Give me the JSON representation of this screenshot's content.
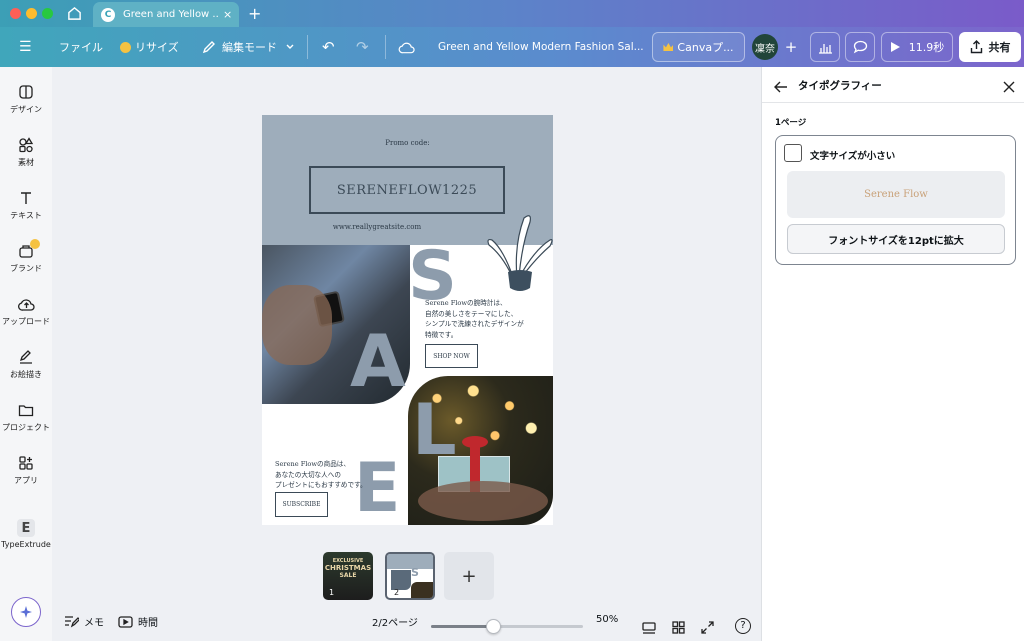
{
  "browser": {
    "tab_title": "Green and Yellow ...",
    "tab_close": "×",
    "new_tab": "+"
  },
  "toolbar": {
    "menu": "☰",
    "file": "ファイル",
    "resize": "リサイズ",
    "edit_mode": "編集モード",
    "undo": "↶",
    "redo": "↷",
    "doc_title": "Green and Yellow Modern Fashion Sal...",
    "canva_pro": "Canvaプ...",
    "avatar": "凜奈",
    "add": "+",
    "timer": "11.9秒",
    "share": "共有"
  },
  "sidebar": {
    "items": [
      {
        "label": "デザイン",
        "icon": "design-icon"
      },
      {
        "label": "素材",
        "icon": "elements-icon"
      },
      {
        "label": "テキスト",
        "icon": "text-icon"
      },
      {
        "label": "ブランド",
        "icon": "brand-icon"
      },
      {
        "label": "アップロード",
        "icon": "upload-icon"
      },
      {
        "label": "お絵描き",
        "icon": "draw-icon"
      },
      {
        "label": "プロジェクト",
        "icon": "folder-icon"
      },
      {
        "label": "アプリ",
        "icon": "apps-icon"
      },
      {
        "label": "TypeExtrude",
        "icon": "typeextrude-icon"
      }
    ]
  },
  "design": {
    "promo_label": "Promo code:",
    "promo_code": "SERENEFLOW1225",
    "website": "www.reallygreatsite.com",
    "letters": [
      "S",
      "A",
      "L",
      "E"
    ],
    "body1_lines": [
      "Serene Flowの腕時計は、",
      "自然の美しさをテーマにした、",
      "シンプルで洗練されたデザインが",
      "特徴です。"
    ],
    "shop_button": "SHOP NOW",
    "body2_lines": [
      "Serene Flowの商品は、",
      "あなたの大切な人への",
      "プレゼントにもおすすめです。"
    ],
    "subscribe_button": "SUBSCRIBE"
  },
  "thumbnails": [
    {
      "number": "1",
      "title_lines": [
        "EXCLUSIVE",
        "CHRISTMAS",
        "SALE"
      ]
    },
    {
      "number": "2",
      "letter": "S"
    }
  ],
  "thumb_add": "+",
  "bottom": {
    "notes": "メモ",
    "timer": "時間",
    "page_indicator": "2/2ページ",
    "zoom": "50%",
    "zoom_fraction": 0.5,
    "help": "?"
  },
  "panel": {
    "title": "タイポグラフィー",
    "section": "1ページ",
    "check_label": "文字サイズが小さい",
    "preview_text": "Serene Flow",
    "fix_button": "フォントサイズを12ptに拡大"
  },
  "colors": {
    "accent_teal": "#40a6bb",
    "accent_purple": "#7c65cc",
    "slate": "#8d9cac",
    "ink": "#3b4a57"
  }
}
